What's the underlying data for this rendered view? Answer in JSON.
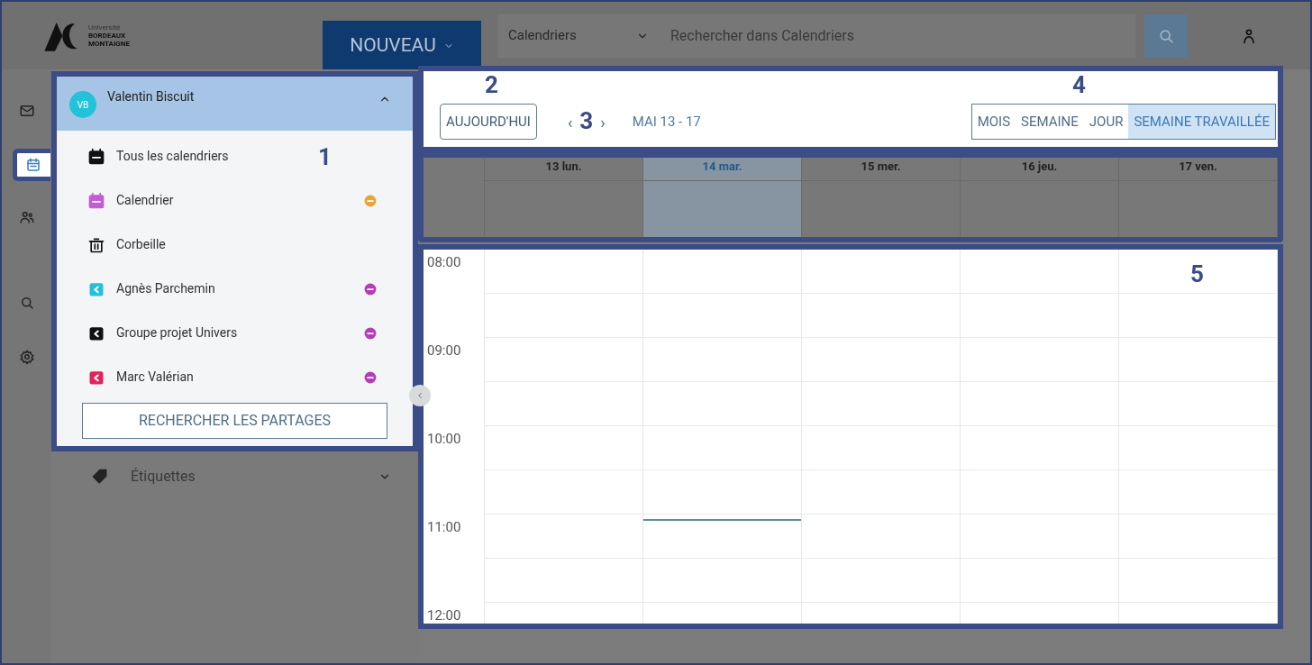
{
  "header": {
    "logo": {
      "line_1": "Université",
      "line_2": "BORDEAUX",
      "line_3": "MONTAIGNE"
    },
    "new_button": "NOUVEAU",
    "scope_select": "Calendriers",
    "search": {
      "placeholder": "Rechercher dans Calendriers"
    }
  },
  "rail": [
    {
      "kind": "mail",
      "selected": false
    },
    {
      "kind": "calendar",
      "selected": true
    },
    {
      "kind": "contacts",
      "selected": false
    },
    {
      "kind": "search",
      "selected": false
    },
    {
      "kind": "settings",
      "selected": false
    }
  ],
  "account": {
    "initials": "VB",
    "name": "Valentin Biscuit",
    "expanded": true
  },
  "calendars": [
    {
      "kind": "all",
      "label": "Tous les calendriers",
      "color": "#111111"
    },
    {
      "kind": "calendar",
      "label": "Calendrier",
      "color": "#c060d0",
      "badge": {
        "color": "#e8a33a"
      }
    },
    {
      "kind": "trash",
      "label": "Corbeille",
      "color": "#111111"
    },
    {
      "kind": "shared",
      "label": "Agnès Parchemin",
      "color": "#26bfd9",
      "badge": {
        "color": "#b23fb5"
      }
    },
    {
      "kind": "shared",
      "label": "Groupe projet Univers",
      "color": "#111111",
      "badge": {
        "color": "#b23fb5"
      }
    },
    {
      "kind": "shared",
      "label": "Marc Valérian",
      "color": "#e0245e",
      "badge": {
        "color": "#b23fb5"
      }
    }
  ],
  "share_search_button": "RECHERCHER LES PARTAGES",
  "labels_section": {
    "label": "Étiquettes",
    "expanded": false
  },
  "toolbar": {
    "today_button": "AUJOURD'HUI",
    "prev": "‹",
    "next": "›",
    "range": "MAI 13 - 17",
    "views": [
      {
        "label": "MOIS",
        "selected": false
      },
      {
        "label": "SEMAINE",
        "selected": false
      },
      {
        "label": "JOUR",
        "selected": false
      },
      {
        "label": "SEMAINE TRAVAILLÉE",
        "selected": true
      }
    ]
  },
  "days": [
    {
      "label": "13 lun.",
      "selected": false,
      "now": false
    },
    {
      "label": "14 mar.",
      "selected": true,
      "now": true
    },
    {
      "label": "15 mer.",
      "selected": false,
      "now": false
    },
    {
      "label": "16 jeu.",
      "selected": false,
      "now": false
    },
    {
      "label": "17 ven.",
      "selected": false,
      "now": false
    }
  ],
  "hours": [
    "08:00",
    "09:00",
    "10:00",
    "11:00",
    "12:00"
  ],
  "annotations": [
    "1",
    "2",
    "3",
    "4",
    "5"
  ]
}
